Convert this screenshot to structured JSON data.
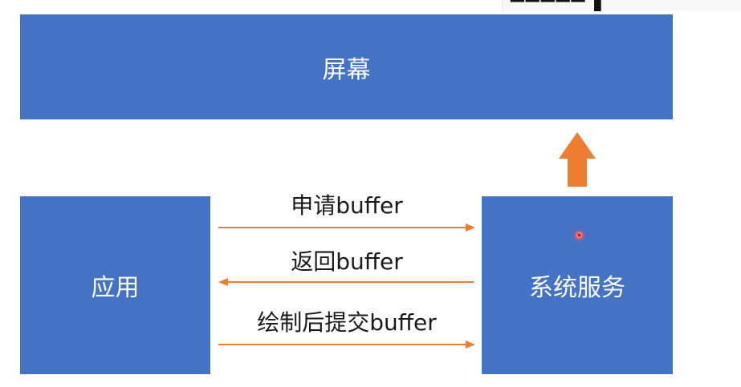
{
  "diagram": {
    "screen_label": "屏幕",
    "app_label": "应用",
    "service_label": "系统服务",
    "arrows": {
      "request_label": "申请buffer",
      "return_label": "返回buffer",
      "submit_label": "绘制后提交buffer"
    }
  },
  "colors": {
    "box_fill": "#4472c4",
    "arrow": "#ed7d31",
    "text_on_box": "#ffffff",
    "text_label": "#1a1a1a"
  }
}
